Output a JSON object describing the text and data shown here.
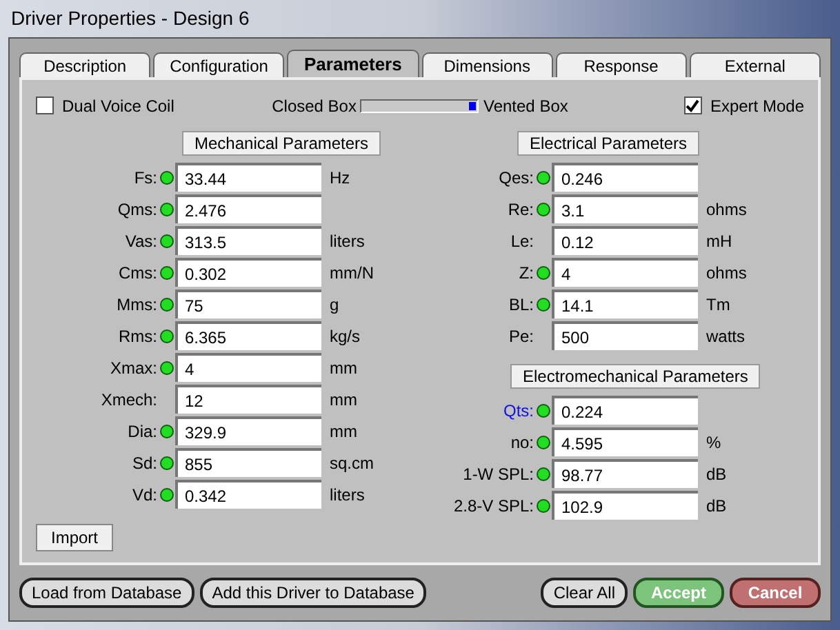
{
  "window": {
    "title": "Driver Properties - Design 6"
  },
  "tabs": [
    {
      "label": "Description",
      "selected": false
    },
    {
      "label": "Configuration",
      "selected": false
    },
    {
      "label": "Parameters",
      "selected": true
    },
    {
      "label": "Dimensions",
      "selected": false
    },
    {
      "label": "Response",
      "selected": false
    },
    {
      "label": "External",
      "selected": false
    }
  ],
  "options": {
    "dual_voice_coil": {
      "label": "Dual Voice Coil",
      "checked": false
    },
    "box_slider": {
      "left_label": "Closed Box",
      "right_label": "Vented Box",
      "level": 1
    },
    "expert_mode": {
      "label": "Expert Mode",
      "checked": true
    }
  },
  "mechanical": {
    "title": "Mechanical Parameters",
    "params": [
      {
        "label": "Fs:",
        "indicator": true,
        "highlighted": false,
        "value": "33.44",
        "unit": "Hz"
      },
      {
        "label": "Qms:",
        "indicator": true,
        "highlighted": false,
        "value": "2.476"
      },
      {
        "label": "Vas:",
        "indicator": true,
        "highlighted": false,
        "value": "313.5",
        "unit": "liters"
      },
      {
        "label": "Cms:",
        "indicator": true,
        "highlighted": false,
        "value": "0.302",
        "unit": "mm/N"
      },
      {
        "label": "Mms:",
        "indicator": true,
        "highlighted": false,
        "value": "75",
        "unit": "g"
      },
      {
        "label": "Rms:",
        "indicator": true,
        "highlighted": false,
        "value": "6.365",
        "unit": "kg/s"
      },
      {
        "label": "Xmax:",
        "indicator": true,
        "highlighted": false,
        "value": "4",
        "unit": "mm"
      },
      {
        "label": "Xmech:",
        "indicator": false,
        "highlighted": false,
        "value": "12",
        "unit": "mm"
      },
      {
        "label": "Dia:",
        "indicator": true,
        "highlighted": false,
        "value": "329.9",
        "unit": "mm"
      },
      {
        "label": "Sd:",
        "indicator": true,
        "highlighted": false,
        "value": "855",
        "unit": "sq.cm"
      },
      {
        "label": "Vd:",
        "indicator": true,
        "highlighted": false,
        "value": "0.342",
        "unit": "liters"
      }
    ]
  },
  "electrical": {
    "title": "Electrical Parameters",
    "params": [
      {
        "label": "Qes:",
        "indicator": true,
        "highlighted": false,
        "value": "0.246"
      },
      {
        "label": "Re:",
        "indicator": true,
        "highlighted": false,
        "value": "3.1",
        "unit": "ohms"
      },
      {
        "label": "Le:",
        "indicator": false,
        "highlighted": false,
        "value": "0.12",
        "unit": "mH"
      },
      {
        "label": "Z:",
        "indicator": true,
        "highlighted": false,
        "value": "4",
        "unit": "ohms"
      },
      {
        "label": "BL:",
        "indicator": true,
        "highlighted": false,
        "value": "14.1",
        "unit": "Tm"
      },
      {
        "label": "Pe:",
        "indicator": false,
        "highlighted": false,
        "value": "500",
        "unit": "watts"
      }
    ]
  },
  "electromechanical": {
    "title": "Electromechanical Parameters",
    "params": [
      {
        "label": "Qts:",
        "indicator": true,
        "highlighted": true,
        "value": "0.224"
      },
      {
        "label": "no:",
        "indicator": true,
        "highlighted": false,
        "value": "4.595",
        "unit": "%"
      },
      {
        "label": "1-W SPL:",
        "indicator": true,
        "highlighted": false,
        "value": "98.77",
        "unit": "dB"
      },
      {
        "label": "2.8-V SPL:",
        "indicator": true,
        "highlighted": false,
        "value": "102.9",
        "unit": "dB"
      }
    ]
  },
  "import_button": "Import",
  "footer_buttons": [
    {
      "label": "Load from Database",
      "kind": "plain"
    },
    {
      "label": "Add this Driver to Database",
      "kind": "plain"
    },
    {
      "label": "Clear All",
      "kind": "plain"
    },
    {
      "label": "Accept",
      "kind": "accept"
    },
    {
      "label": "Cancel",
      "kind": "cancel"
    }
  ]
}
